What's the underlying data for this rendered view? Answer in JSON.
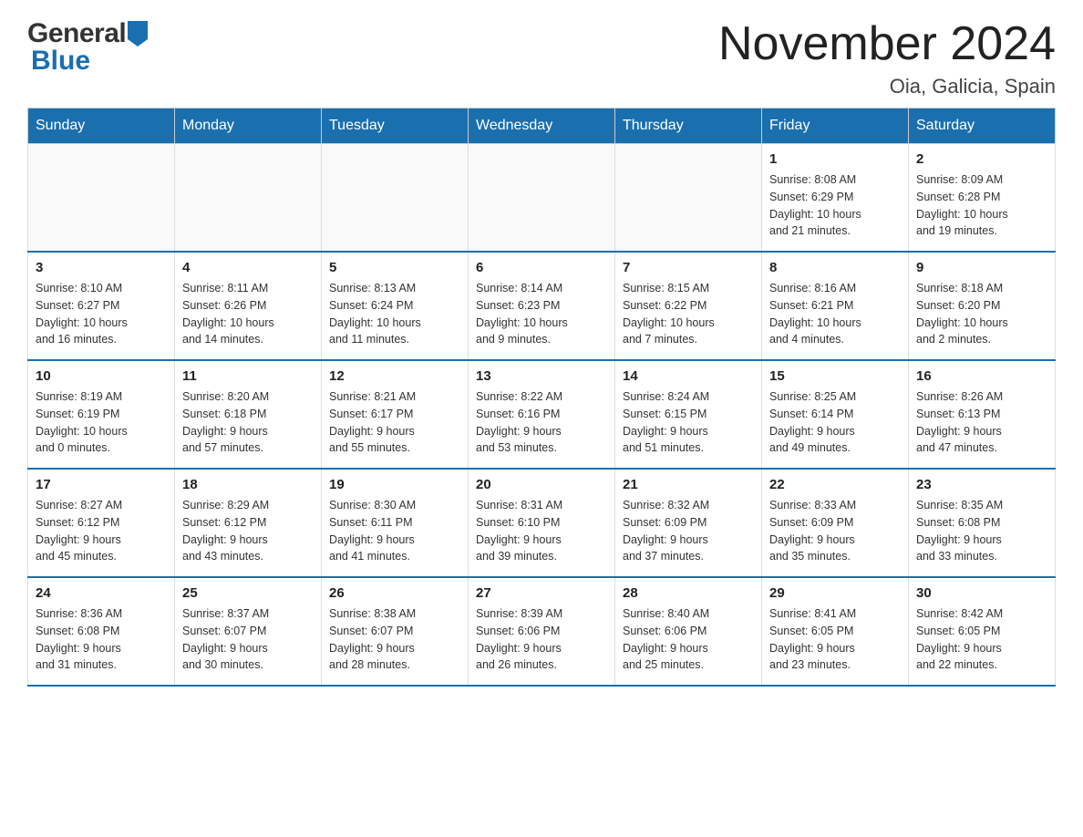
{
  "logo": {
    "general": "General",
    "blue": "Blue"
  },
  "title": "November 2024",
  "subtitle": "Oia, Galicia, Spain",
  "weekdays": [
    "Sunday",
    "Monday",
    "Tuesday",
    "Wednesday",
    "Thursday",
    "Friday",
    "Saturday"
  ],
  "weeks": [
    [
      {
        "day": "",
        "info": ""
      },
      {
        "day": "",
        "info": ""
      },
      {
        "day": "",
        "info": ""
      },
      {
        "day": "",
        "info": ""
      },
      {
        "day": "",
        "info": ""
      },
      {
        "day": "1",
        "info": "Sunrise: 8:08 AM\nSunset: 6:29 PM\nDaylight: 10 hours\nand 21 minutes."
      },
      {
        "day": "2",
        "info": "Sunrise: 8:09 AM\nSunset: 6:28 PM\nDaylight: 10 hours\nand 19 minutes."
      }
    ],
    [
      {
        "day": "3",
        "info": "Sunrise: 8:10 AM\nSunset: 6:27 PM\nDaylight: 10 hours\nand 16 minutes."
      },
      {
        "day": "4",
        "info": "Sunrise: 8:11 AM\nSunset: 6:26 PM\nDaylight: 10 hours\nand 14 minutes."
      },
      {
        "day": "5",
        "info": "Sunrise: 8:13 AM\nSunset: 6:24 PM\nDaylight: 10 hours\nand 11 minutes."
      },
      {
        "day": "6",
        "info": "Sunrise: 8:14 AM\nSunset: 6:23 PM\nDaylight: 10 hours\nand 9 minutes."
      },
      {
        "day": "7",
        "info": "Sunrise: 8:15 AM\nSunset: 6:22 PM\nDaylight: 10 hours\nand 7 minutes."
      },
      {
        "day": "8",
        "info": "Sunrise: 8:16 AM\nSunset: 6:21 PM\nDaylight: 10 hours\nand 4 minutes."
      },
      {
        "day": "9",
        "info": "Sunrise: 8:18 AM\nSunset: 6:20 PM\nDaylight: 10 hours\nand 2 minutes."
      }
    ],
    [
      {
        "day": "10",
        "info": "Sunrise: 8:19 AM\nSunset: 6:19 PM\nDaylight: 10 hours\nand 0 minutes."
      },
      {
        "day": "11",
        "info": "Sunrise: 8:20 AM\nSunset: 6:18 PM\nDaylight: 9 hours\nand 57 minutes."
      },
      {
        "day": "12",
        "info": "Sunrise: 8:21 AM\nSunset: 6:17 PM\nDaylight: 9 hours\nand 55 minutes."
      },
      {
        "day": "13",
        "info": "Sunrise: 8:22 AM\nSunset: 6:16 PM\nDaylight: 9 hours\nand 53 minutes."
      },
      {
        "day": "14",
        "info": "Sunrise: 8:24 AM\nSunset: 6:15 PM\nDaylight: 9 hours\nand 51 minutes."
      },
      {
        "day": "15",
        "info": "Sunrise: 8:25 AM\nSunset: 6:14 PM\nDaylight: 9 hours\nand 49 minutes."
      },
      {
        "day": "16",
        "info": "Sunrise: 8:26 AM\nSunset: 6:13 PM\nDaylight: 9 hours\nand 47 minutes."
      }
    ],
    [
      {
        "day": "17",
        "info": "Sunrise: 8:27 AM\nSunset: 6:12 PM\nDaylight: 9 hours\nand 45 minutes."
      },
      {
        "day": "18",
        "info": "Sunrise: 8:29 AM\nSunset: 6:12 PM\nDaylight: 9 hours\nand 43 minutes."
      },
      {
        "day": "19",
        "info": "Sunrise: 8:30 AM\nSunset: 6:11 PM\nDaylight: 9 hours\nand 41 minutes."
      },
      {
        "day": "20",
        "info": "Sunrise: 8:31 AM\nSunset: 6:10 PM\nDaylight: 9 hours\nand 39 minutes."
      },
      {
        "day": "21",
        "info": "Sunrise: 8:32 AM\nSunset: 6:09 PM\nDaylight: 9 hours\nand 37 minutes."
      },
      {
        "day": "22",
        "info": "Sunrise: 8:33 AM\nSunset: 6:09 PM\nDaylight: 9 hours\nand 35 minutes."
      },
      {
        "day": "23",
        "info": "Sunrise: 8:35 AM\nSunset: 6:08 PM\nDaylight: 9 hours\nand 33 minutes."
      }
    ],
    [
      {
        "day": "24",
        "info": "Sunrise: 8:36 AM\nSunset: 6:08 PM\nDaylight: 9 hours\nand 31 minutes."
      },
      {
        "day": "25",
        "info": "Sunrise: 8:37 AM\nSunset: 6:07 PM\nDaylight: 9 hours\nand 30 minutes."
      },
      {
        "day": "26",
        "info": "Sunrise: 8:38 AM\nSunset: 6:07 PM\nDaylight: 9 hours\nand 28 minutes."
      },
      {
        "day": "27",
        "info": "Sunrise: 8:39 AM\nSunset: 6:06 PM\nDaylight: 9 hours\nand 26 minutes."
      },
      {
        "day": "28",
        "info": "Sunrise: 8:40 AM\nSunset: 6:06 PM\nDaylight: 9 hours\nand 25 minutes."
      },
      {
        "day": "29",
        "info": "Sunrise: 8:41 AM\nSunset: 6:05 PM\nDaylight: 9 hours\nand 23 minutes."
      },
      {
        "day": "30",
        "info": "Sunrise: 8:42 AM\nSunset: 6:05 PM\nDaylight: 9 hours\nand 22 minutes."
      }
    ]
  ]
}
